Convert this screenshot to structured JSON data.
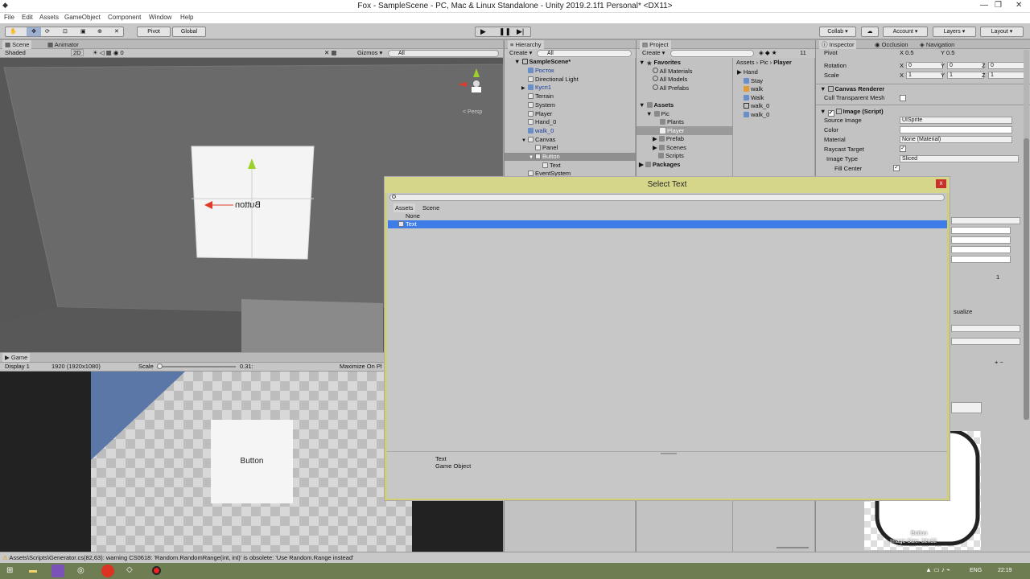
{
  "window": {
    "title": "Fox - SampleScene - PC, Mac & Linux Standalone - Unity 2019.2.1f1 Personal* <DX11>",
    "minimize": "—",
    "maximize": "❐",
    "close": "✕"
  },
  "menu": [
    "File",
    "Edit",
    "Assets",
    "GameObject",
    "Component",
    "Window",
    "Help"
  ],
  "toolbar": {
    "pivot": "Pivot",
    "global": "Global",
    "collab": "Collab ▾",
    "account": "Account",
    "layers": "Layers",
    "layout": "Layout"
  },
  "scene": {
    "tabs": [
      "Scene",
      "Animator"
    ],
    "shading": "Shaded",
    "mode2d": "2D",
    "gizmos": "Gizmos ▾",
    "search": "All",
    "persp": "< Persp",
    "button_text": "Button"
  },
  "game": {
    "tab": "Game",
    "display": "Display 1",
    "resolution": "1920 (1920x1080)",
    "scale_label": "Scale",
    "scale_value": "0.31:",
    "maximize": "Maximize On Pl",
    "button_text": "Button"
  },
  "hierarchy": {
    "tab": "Hierarchy",
    "create": "Create ▾",
    "search": "All",
    "scene_name": "SampleScene*",
    "items": [
      {
        "label": "Росток",
        "indent": 1,
        "blue": true,
        "arrow": ""
      },
      {
        "label": "Directional Light",
        "indent": 1,
        "blue": false,
        "arrow": ""
      },
      {
        "label": "Кусп1",
        "indent": 1,
        "blue": true,
        "arrow": "▶"
      },
      {
        "label": "Terrain",
        "indent": 1,
        "blue": false,
        "arrow": ""
      },
      {
        "label": "System",
        "indent": 1,
        "blue": false,
        "arrow": ""
      },
      {
        "label": "Player",
        "indent": 1,
        "blue": false,
        "arrow": ""
      },
      {
        "label": "Hand_0",
        "indent": 1,
        "blue": false,
        "arrow": ""
      },
      {
        "label": "walk_0",
        "indent": 1,
        "blue": true,
        "arrow": ""
      },
      {
        "label": "Canvas",
        "indent": 1,
        "blue": false,
        "arrow": "▼"
      },
      {
        "label": "Panel",
        "indent": 2,
        "blue": false,
        "arrow": ""
      },
      {
        "label": "Button",
        "indent": 2,
        "blue": false,
        "arrow": "▼",
        "selected": true
      },
      {
        "label": "Text",
        "indent": 3,
        "blue": false,
        "arrow": ""
      },
      {
        "label": "EventSystem",
        "indent": 1,
        "blue": false,
        "arrow": ""
      }
    ]
  },
  "project": {
    "tab": "Project",
    "create": "Create ▾",
    "favorites": "Favorites",
    "fav_items": [
      "All Materials",
      "All Models",
      "All Prefabs"
    ],
    "assets": "Assets",
    "pic": "Pic",
    "plants": "Plants",
    "player": "Player",
    "prefab": "Prefab",
    "scenes": "Scenes",
    "scripts": "Scripts",
    "packages": "Packages",
    "breadcrumb": [
      "Assets",
      "Pic",
      "Player"
    ],
    "files": [
      "Hand",
      "Stay",
      "walk",
      "Walk",
      "walk_0",
      "walk_0"
    ],
    "count": "11"
  },
  "inspector": {
    "tabs": [
      "Inspector",
      "Occlusion",
      "Navigation"
    ],
    "pivot_label": "Pivot",
    "pivot_x": "0.5",
    "pivot_y": "0.5",
    "rotation_label": "Rotation",
    "rot": [
      "0",
      "0",
      "0"
    ],
    "scale_label": "Scale",
    "scl": [
      "1",
      "1",
      "1"
    ],
    "canvas_renderer": "Canvas Renderer",
    "cull": "Cull Transparent Mesh",
    "image_script": "Image (Script)",
    "source_image_label": "Source Image",
    "source_image": "UISprite",
    "color_label": "Color",
    "material_label": "Material",
    "material": "None (Material)",
    "raycast_label": "Raycast Target",
    "image_type_label": "Image Type",
    "image_type": "Sliced",
    "fill_center_label": "Fill Center",
    "slider_value": "1",
    "visualize": "sualize",
    "preview_text": "Button",
    "image_size": "Image Size: 32x32"
  },
  "dialog": {
    "title": "Select Text",
    "close": "x",
    "tabs": [
      "Assets",
      "Scene"
    ],
    "none": "None",
    "selected_item": "Text",
    "footer_name": "Text",
    "footer_type": "Game Object"
  },
  "status": {
    "warning": "Assets\\Scripts\\Generator.cs(82,63): warning CS0618: 'Random.RandomRange(int, int)' is obsolete: 'Use Random.Range instead'"
  },
  "taskbar": {
    "lang": "ENG",
    "time": "22:19"
  },
  "colors": {
    "selection": "#3e7ce8",
    "dialog_frame": "#cfcf7a",
    "panel_bg": "#c2c2c2"
  }
}
